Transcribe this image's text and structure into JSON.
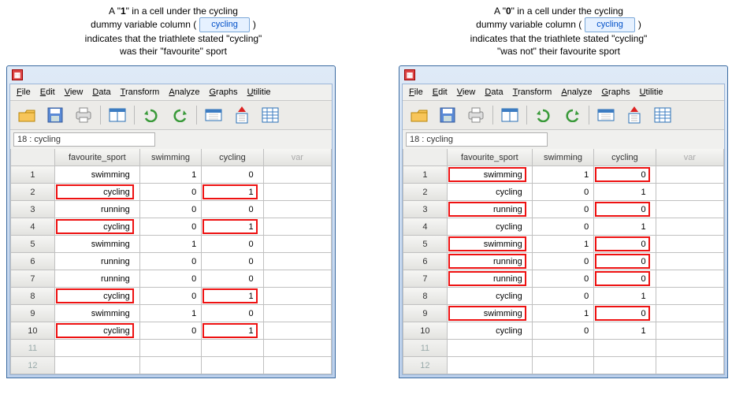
{
  "captions": {
    "left": {
      "l1a": "A \"",
      "l1b": "1",
      "l1c": "\" in a cell under the cycling",
      "l2a": "dummy variable column (",
      "chip": "cycling",
      "l2b": ")",
      "l3": "indicates that the triathlete stated \"cycling\"",
      "l4": "was their \"favourite\" sport"
    },
    "right": {
      "l1a": "A \"",
      "l1b": "0",
      "l1c": "\" in a cell under the cycling",
      "l2a": "dummy variable column (",
      "chip": "cycling",
      "l2b": ")",
      "l3": "indicates that the triathlete stated \"cycling\"",
      "l4": "\"was not\" their favourite sport"
    }
  },
  "menus": {
    "file": "File",
    "edit": "Edit",
    "view": "View",
    "data": "Data",
    "transform": "Transform",
    "analyze": "Analyze",
    "graphs": "Graphs",
    "utilities": "Utilitie"
  },
  "status": {
    "value": "18 : cycling"
  },
  "columns": {
    "favourite": "favourite_sport",
    "swim": "swimming",
    "cyc": "cycling",
    "var": "var"
  },
  "rows": {
    "1": {
      "n": "1",
      "f": "swimming",
      "s": "1",
      "c": "0"
    },
    "2": {
      "n": "2",
      "f": "cycling",
      "s": "0",
      "c": "1"
    },
    "3": {
      "n": "3",
      "f": "running",
      "s": "0",
      "c": "0"
    },
    "4": {
      "n": "4",
      "f": "cycling",
      "s": "0",
      "c": "1"
    },
    "5": {
      "n": "5",
      "f": "swimming",
      "s": "1",
      "c": "0"
    },
    "6": {
      "n": "6",
      "f": "running",
      "s": "0",
      "c": "0"
    },
    "7": {
      "n": "7",
      "f": "running",
      "s": "0",
      "c": "0"
    },
    "8": {
      "n": "8",
      "f": "cycling",
      "s": "0",
      "c": "1"
    },
    "9": {
      "n": "9",
      "f": "swimming",
      "s": "1",
      "c": "0"
    },
    "10": {
      "n": "10",
      "f": "cycling",
      "s": "0",
      "c": "1"
    },
    "11": {
      "n": "11"
    },
    "12": {
      "n": "12"
    }
  },
  "highlights": {
    "left": {
      "favourite": [
        "2",
        "4",
        "8",
        "10"
      ],
      "cycling": [
        "2",
        "4",
        "8",
        "10"
      ]
    },
    "right": {
      "favourite": [
        "1",
        "3",
        "5",
        "6",
        "7",
        "9"
      ],
      "cycling": [
        "1",
        "3",
        "5",
        "6",
        "7",
        "9"
      ]
    }
  },
  "icons": {
    "spss": "▦"
  }
}
